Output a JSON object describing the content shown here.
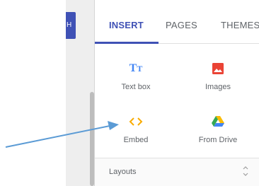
{
  "left_button": {
    "label": "H",
    "color": "#3f51b5"
  },
  "tabs": [
    {
      "label": "INSERT",
      "active": true
    },
    {
      "label": "PAGES",
      "active": false
    },
    {
      "label": "THEMES",
      "active": false
    }
  ],
  "insert_items": {
    "textbox": {
      "label": "Text box",
      "icon": "text-box-icon"
    },
    "images": {
      "label": "Images",
      "icon": "image-icon"
    },
    "embed": {
      "label": "Embed",
      "icon": "embed-code-icon"
    },
    "drive": {
      "label": "From Drive",
      "icon": "google-drive-icon"
    }
  },
  "layouts": {
    "label": "Layouts"
  },
  "colors": {
    "accent": "#3f51b5",
    "textbox_icon": "#4285f4",
    "image_icon": "#ea4335",
    "embed_icon": "#f9ab00",
    "arrow": "#5b9bd5"
  }
}
